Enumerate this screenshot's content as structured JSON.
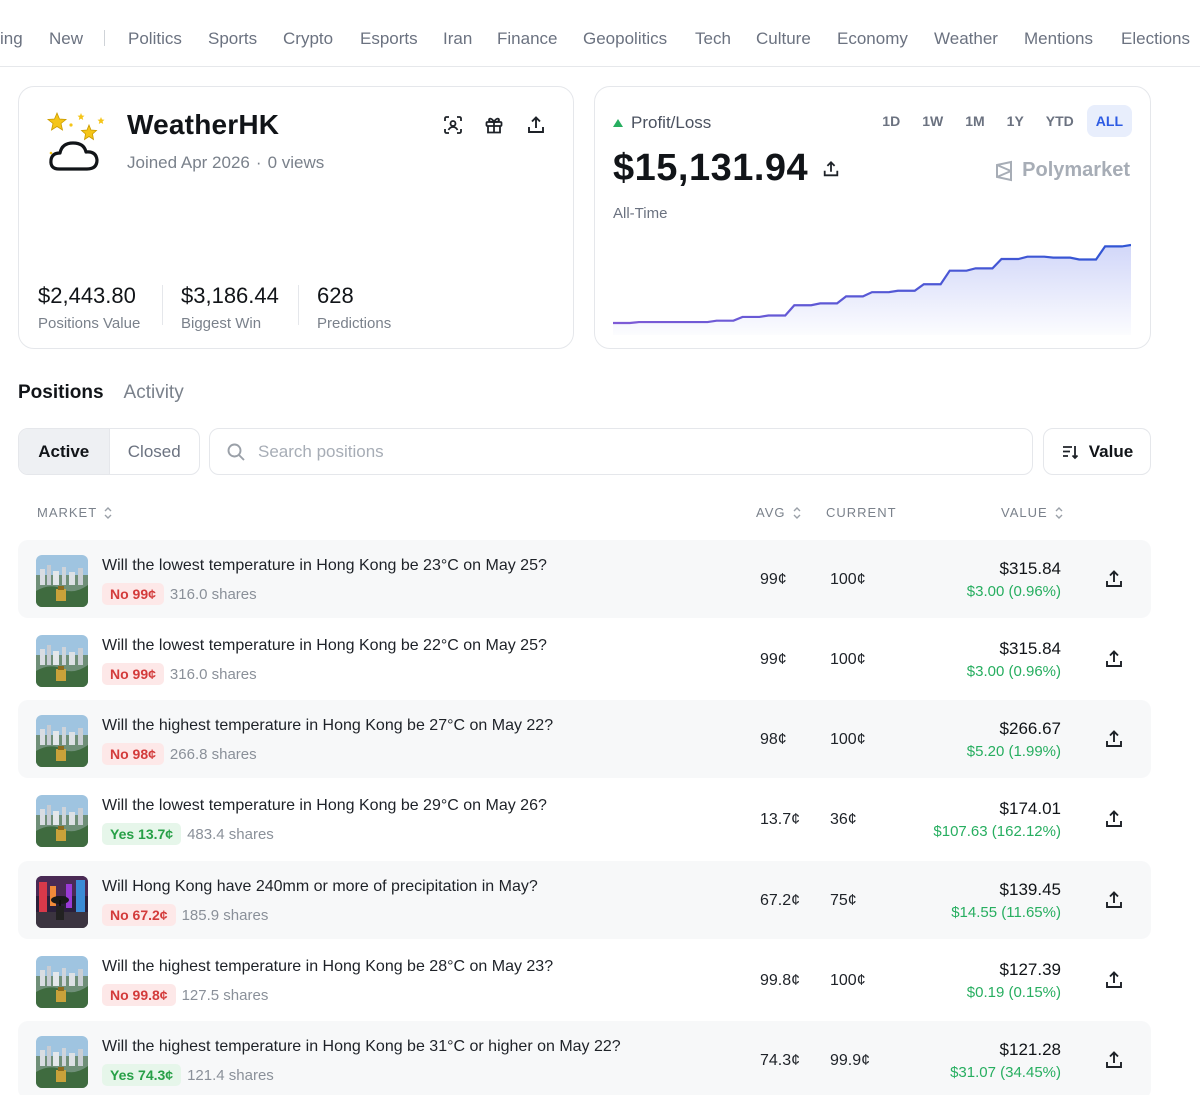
{
  "nav": {
    "items": [
      "ing",
      "New",
      "Politics",
      "Sports",
      "Crypto",
      "Esports",
      "Iran",
      "Finance",
      "Geopolitics",
      "Tech",
      "Culture",
      "Economy",
      "Weather",
      "Mentions",
      "Elections"
    ]
  },
  "profile": {
    "username": "WeatherHK",
    "joined": "Joined Apr 2026",
    "separator": "·",
    "views": "0 views",
    "stats": [
      {
        "value": "$2,443.80",
        "label": "Positions Value"
      },
      {
        "value": "$3,186.44",
        "label": "Biggest Win"
      },
      {
        "value": "628",
        "label": "Predictions"
      }
    ]
  },
  "pnl": {
    "label": "Profit/Loss",
    "value": "$15,131.94",
    "period": "All-Time",
    "brand": "Polymarket",
    "ranges": [
      "1D",
      "1W",
      "1M",
      "1Y",
      "YTD",
      "ALL"
    ],
    "active_range": "ALL",
    "trend_color": "#2f55d4",
    "chart_points": [
      0,
      0.2,
      0.2,
      0.2,
      0.5,
      1.3,
      1.6,
      3.8,
      4.2,
      5.7,
      6.6,
      6.9,
      8.3,
      11.2,
      11.7,
      13.7,
      14.2,
      14.0,
      13.6,
      16.4,
      16.7
    ]
  },
  "tabs": {
    "positions": "Positions",
    "activity": "Activity"
  },
  "filters": {
    "active": "Active",
    "closed": "Closed",
    "search_placeholder": "Search positions",
    "sort": "Value"
  },
  "table": {
    "headers": {
      "market": "MARKET",
      "avg": "AVG",
      "current": "CURRENT",
      "value": "VALUE"
    },
    "rows": [
      {
        "title": "Will the lowest temperature in Hong Kong be 23°C on May 25?",
        "outcome": "No 99¢",
        "side": "no",
        "shares": "316.0 shares",
        "avg": "99¢",
        "current": "100¢",
        "value": "$315.84",
        "change": "$3.00 (0.96%)",
        "thumb": "city"
      },
      {
        "title": "Will the lowest temperature in Hong Kong be 22°C on May 25?",
        "outcome": "No 99¢",
        "side": "no",
        "shares": "316.0 shares",
        "avg": "99¢",
        "current": "100¢",
        "value": "$315.84",
        "change": "$3.00 (0.96%)",
        "thumb": "city"
      },
      {
        "title": "Will the highest temperature in Hong Kong be 27°C on May 22?",
        "outcome": "No 98¢",
        "side": "no",
        "shares": "266.8 shares",
        "avg": "98¢",
        "current": "100¢",
        "value": "$266.67",
        "change": "$5.20 (1.99%)",
        "thumb": "city"
      },
      {
        "title": "Will the lowest temperature in Hong Kong be 29°C on May 26?",
        "outcome": "Yes 13.7¢",
        "side": "yes",
        "shares": "483.4 shares",
        "avg": "13.7¢",
        "current": "36¢",
        "value": "$174.01",
        "change": "$107.63 (162.12%)",
        "thumb": "city"
      },
      {
        "title": "Will Hong Kong have 240mm or more of precipitation in May?",
        "outcome": "No 67.2¢",
        "side": "no",
        "shares": "185.9 shares",
        "avg": "67.2¢",
        "current": "75¢",
        "value": "$139.45",
        "change": "$14.55 (11.65%)",
        "thumb": "rain"
      },
      {
        "title": "Will the highest temperature in Hong Kong be 28°C on May 23?",
        "outcome": "No 99.8¢",
        "side": "no",
        "shares": "127.5 shares",
        "avg": "99.8¢",
        "current": "100¢",
        "value": "$127.39",
        "change": "$0.19 (0.15%)",
        "thumb": "city"
      },
      {
        "title": "Will the highest temperature in Hong Kong be 31°C or higher on May 22?",
        "outcome": "Yes 74.3¢",
        "side": "yes",
        "shares": "121.4 shares",
        "avg": "74.3¢",
        "current": "99.9¢",
        "value": "$121.28",
        "change": "$31.07 (34.45%)",
        "thumb": "city"
      }
    ]
  }
}
